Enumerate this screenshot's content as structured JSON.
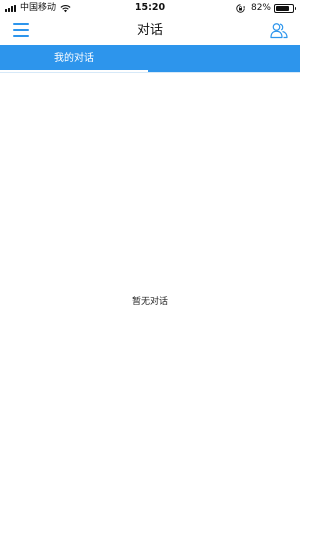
{
  "status_bar": {
    "carrier": "中国移动",
    "time": "15:20",
    "battery_percent": "82%",
    "battery_level": 0.82,
    "icons": [
      "signal-icon",
      "wifi-icon",
      "rotation-lock-icon",
      "battery-icon"
    ]
  },
  "nav_bar": {
    "title": "对话",
    "left_icon": "menu-icon",
    "right_icon": "contacts-icon",
    "accent_color": "#2d95ec"
  },
  "tabs": [
    {
      "label": "我的对话",
      "active": true
    },
    {
      "label": "",
      "active": false
    }
  ],
  "content": {
    "empty_message": "暂无对话"
  }
}
